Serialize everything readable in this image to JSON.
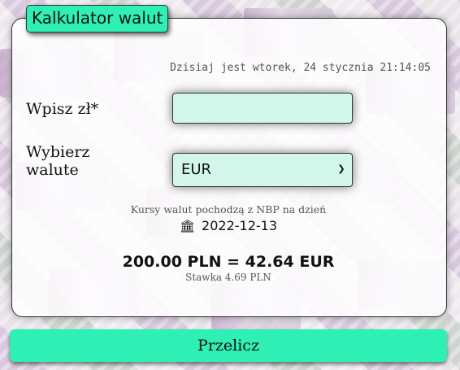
{
  "app": {
    "title": "Kalkulator walut"
  },
  "header": {
    "date_text": "Dzisiaj jest wtorek, 24 stycznia 21:14:05"
  },
  "form": {
    "amount_label": "Wpisz zł*",
    "amount_value": "",
    "currency_label": "Wybierz walute",
    "currency_selected": "EUR"
  },
  "rates": {
    "source_text": "Kursy walut pochodzą z NBP na dzień",
    "date": "2022-12-13",
    "icon": "bank-icon"
  },
  "result": {
    "conversion": "200.00 PLN = 42.64 EUR",
    "rate_text": "Stawka 4.69 PLN"
  },
  "actions": {
    "convert_label": "Przelicz"
  },
  "colors": {
    "accent": "#2ef0b5",
    "input_bg": "#d2f7ea"
  }
}
